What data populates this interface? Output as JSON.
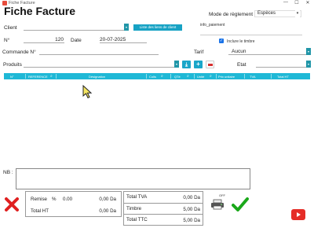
{
  "window": {
    "title": "Fiche Facture",
    "minimize": "—",
    "maximize": "☐",
    "close": "✕"
  },
  "page_title": "Fiche Facture",
  "client": {
    "label": "Client",
    "value": "",
    "list_button": "Liste des liens de client"
  },
  "payment": {
    "label": "Mode de règlement",
    "value": "Espèces",
    "info_label": "info_paiement"
  },
  "invoice": {
    "number_label": "N°",
    "number": "120",
    "date_label": "Date",
    "date": "20-07-2025",
    "timbre_label": "Inclure le timbre",
    "timbre_checked": true
  },
  "order": {
    "label": "Commande N°",
    "value": ""
  },
  "tarif": {
    "label": "Tarif",
    "value": "Aucun"
  },
  "products": {
    "label": "Produits",
    "etat_label": "Etat",
    "etat_value": ""
  },
  "table": {
    "columns": [
      "N°",
      "REFERENCE",
      "Désignation",
      "Colis",
      "QTé",
      "Unité",
      "Prix unitaire",
      "TVA",
      "Total HT"
    ],
    "rows": []
  },
  "nb": {
    "label": "NB :",
    "value": ""
  },
  "summary": {
    "remise_label": "Remise",
    "remise_pct_symbol": "%",
    "remise_pct": "0.00",
    "remise_amount": "0,00 Da",
    "total_ht_label": "Total HT",
    "total_ht": "0,00 Da",
    "total_tva_label": "Total TVA",
    "total_tva": "0,00 Da",
    "timbre_label": "Timbre",
    "timbre": "5,00 Da",
    "total_ttc_label": "Total TTC",
    "total_ttc": "5,00 Da"
  },
  "print_toggle": "OFF",
  "colors": {
    "accent": "#1fb8d6",
    "cancel": "#e02020",
    "confirm": "#1aa81a"
  }
}
